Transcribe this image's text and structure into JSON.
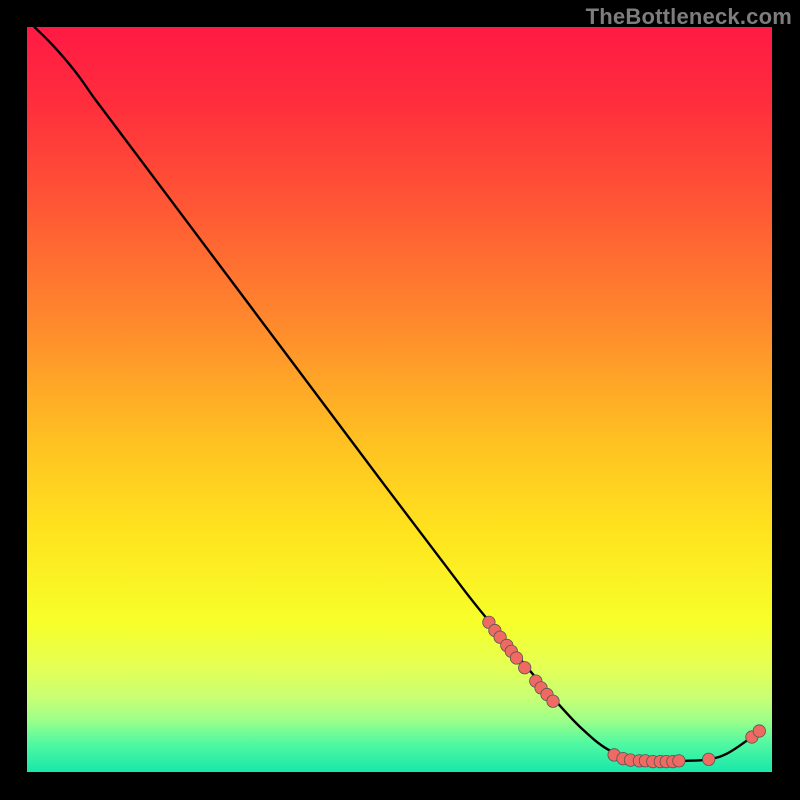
{
  "watermark": "TheBottleneck.com",
  "colors": {
    "frame": "#000000",
    "line": "#000000",
    "dot_fill": "#ef6a62",
    "dot_stroke": "#555555",
    "gradient_stops": [
      {
        "offset": 0.0,
        "color": "#ff1a44"
      },
      {
        "offset": 0.1,
        "color": "#ff2d3d"
      },
      {
        "offset": 0.25,
        "color": "#ff5a34"
      },
      {
        "offset": 0.4,
        "color": "#ff8a2d"
      },
      {
        "offset": 0.55,
        "color": "#ffbf22"
      },
      {
        "offset": 0.68,
        "color": "#ffe41e"
      },
      {
        "offset": 0.8,
        "color": "#f7ff2a"
      },
      {
        "offset": 0.86,
        "color": "#e4ff55"
      },
      {
        "offset": 0.9,
        "color": "#c8ff74"
      },
      {
        "offset": 0.93,
        "color": "#9dff89"
      },
      {
        "offset": 0.96,
        "color": "#55f9a0"
      },
      {
        "offset": 1.0,
        "color": "#16e8ab"
      }
    ]
  },
  "chart_data": {
    "type": "line",
    "title": "",
    "xlabel": "",
    "ylabel": "",
    "xlim": [
      0,
      100
    ],
    "ylim": [
      0,
      100
    ],
    "annotations": [],
    "series": [
      {
        "name": "bottleneck-curve",
        "points": [
          {
            "x": 1.0,
            "y": 100.0
          },
          {
            "x": 3.5,
            "y": 97.5
          },
          {
            "x": 6.5,
            "y": 94.0
          },
          {
            "x": 9.0,
            "y": 90.5
          },
          {
            "x": 12.0,
            "y": 86.5
          },
          {
            "x": 24.0,
            "y": 70.5
          },
          {
            "x": 36.0,
            "y": 54.5
          },
          {
            "x": 48.0,
            "y": 38.5
          },
          {
            "x": 59.0,
            "y": 24.0
          },
          {
            "x": 63.5,
            "y": 18.5
          },
          {
            "x": 67.0,
            "y": 14.2
          },
          {
            "x": 71.0,
            "y": 9.5
          },
          {
            "x": 74.5,
            "y": 5.8
          },
          {
            "x": 78.0,
            "y": 3.0
          },
          {
            "x": 81.5,
            "y": 1.7
          },
          {
            "x": 85.0,
            "y": 1.5
          },
          {
            "x": 88.5,
            "y": 1.5
          },
          {
            "x": 91.5,
            "y": 1.7
          },
          {
            "x": 94.0,
            "y": 2.5
          },
          {
            "x": 97.0,
            "y": 4.5
          },
          {
            "x": 98.5,
            "y": 5.8
          }
        ]
      }
    ],
    "scatter_groups": [
      {
        "name": "upper-segment-dots",
        "points": [
          {
            "x": 62.0,
            "y": 20.1
          },
          {
            "x": 62.8,
            "y": 19.0
          },
          {
            "x": 63.5,
            "y": 18.1
          },
          {
            "x": 64.4,
            "y": 17.0
          },
          {
            "x": 65.0,
            "y": 16.2
          },
          {
            "x": 65.7,
            "y": 15.3
          },
          {
            "x": 66.8,
            "y": 14.0
          },
          {
            "x": 68.3,
            "y": 12.2
          },
          {
            "x": 69.0,
            "y": 11.3
          },
          {
            "x": 69.8,
            "y": 10.4
          },
          {
            "x": 70.6,
            "y": 9.5
          }
        ]
      },
      {
        "name": "trough-dots",
        "points": [
          {
            "x": 78.8,
            "y": 2.3
          },
          {
            "x": 80.0,
            "y": 1.8
          },
          {
            "x": 81.0,
            "y": 1.6
          },
          {
            "x": 82.2,
            "y": 1.5
          },
          {
            "x": 83.0,
            "y": 1.5
          },
          {
            "x": 84.0,
            "y": 1.4
          },
          {
            "x": 85.0,
            "y": 1.4
          },
          {
            "x": 85.8,
            "y": 1.4
          },
          {
            "x": 86.7,
            "y": 1.4
          },
          {
            "x": 87.5,
            "y": 1.5
          },
          {
            "x": 91.5,
            "y": 1.7
          }
        ]
      },
      {
        "name": "right-tail-dots",
        "points": [
          {
            "x": 97.3,
            "y": 4.7
          },
          {
            "x": 98.3,
            "y": 5.5
          }
        ]
      }
    ]
  }
}
